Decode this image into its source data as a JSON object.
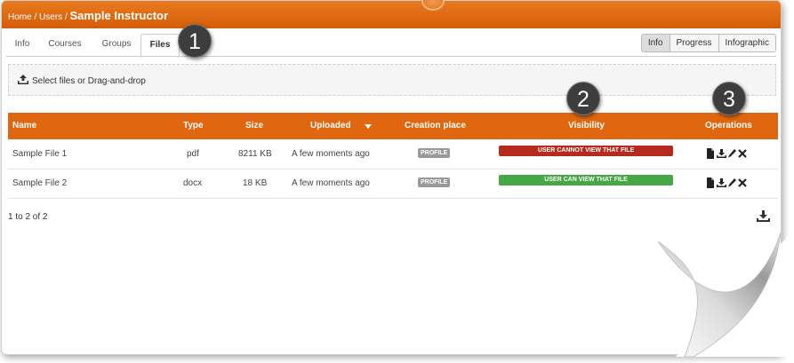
{
  "breadcrumb": {
    "home": "Home",
    "users": "Users",
    "current": "Sample Instructor"
  },
  "tabs": [
    {
      "label": "Info"
    },
    {
      "label": "Courses"
    },
    {
      "label": "Groups"
    },
    {
      "label": "Files",
      "active": true
    }
  ],
  "badges": [
    "1",
    "2",
    "3"
  ],
  "view_buttons": [
    {
      "label": "Info",
      "active": true
    },
    {
      "label": "Progress"
    },
    {
      "label": "Infographic"
    }
  ],
  "upload": {
    "label": "Select files or Drag-and-drop",
    "icon": "upload-icon"
  },
  "table": {
    "headers": {
      "name": "Name",
      "type": "Type",
      "size": "Size",
      "uploaded": "Uploaded",
      "creation": "Creation place",
      "visibility": "Visibility",
      "operations": "Operations"
    },
    "sort_icon": "sort-desc-icon",
    "rows": [
      {
        "name": "Sample File 1",
        "type": "pdf",
        "size": "8211 KB",
        "uploaded": "A few moments ago",
        "creation": "PROFILE",
        "visibility": "USER CANNOT VIEW THAT FILE",
        "visibility_color": "#b52a1d"
      },
      {
        "name": "Sample File 2",
        "type": "docx",
        "size": "18 KB",
        "uploaded": "A few moments ago",
        "creation": "PROFILE",
        "visibility": "USER CAN VIEW THAT FILE",
        "visibility_color": "#45a845"
      }
    ],
    "operation_icons": [
      "file-icon",
      "download-icon",
      "pencil-icon",
      "delete-icon"
    ]
  },
  "pagination": {
    "text": "1 to 2 of 2"
  },
  "export_icon": "export-icon",
  "colors": {
    "accent": "#e0670f",
    "header": "#d45d09"
  }
}
